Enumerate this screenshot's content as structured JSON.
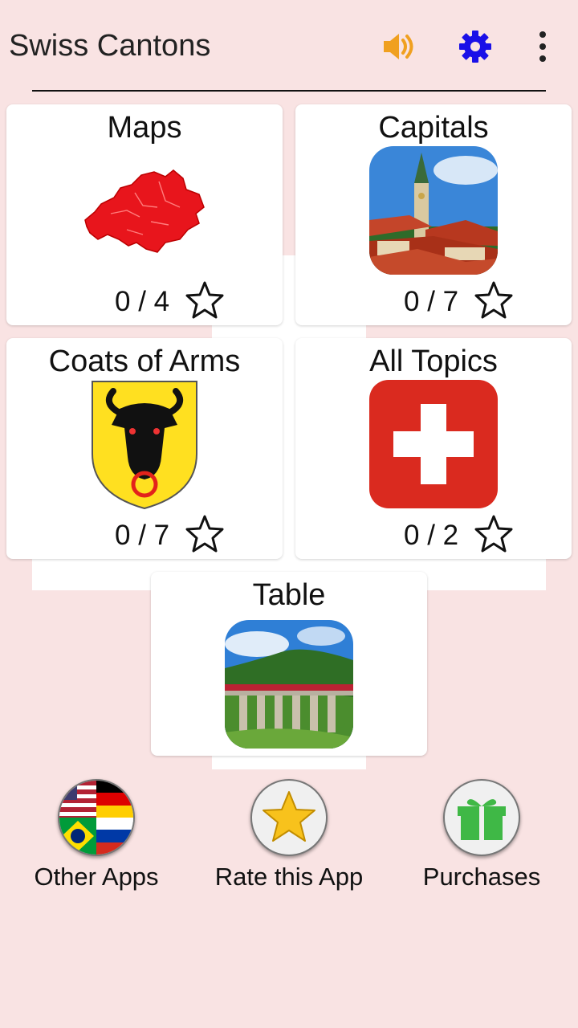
{
  "app": {
    "title": "Swiss Cantons",
    "accent_orange": "#f0a020",
    "accent_blue": "#1a10e8"
  },
  "toolbar": {
    "sound_icon": "speaker-icon",
    "settings_icon": "gear-icon",
    "menu_icon": "more-vert-icon"
  },
  "cards": [
    {
      "title": "Maps",
      "score": "0 / 4",
      "image": "swiss-map-red"
    },
    {
      "title": "Capitals",
      "score": "0 / 7",
      "image": "bern-old-town-photo"
    },
    {
      "title": "Coats of Arms",
      "score": "0 / 7",
      "image": "uri-coat-of-arms"
    },
    {
      "title": "All Topics",
      "score": "0 / 2",
      "image": "swiss-flag"
    },
    {
      "title": "Table",
      "image": "viaduct-train-photo"
    }
  ],
  "bottom": {
    "other_apps": "Other Apps",
    "rate": "Rate this App",
    "purchases": "Purchases"
  }
}
